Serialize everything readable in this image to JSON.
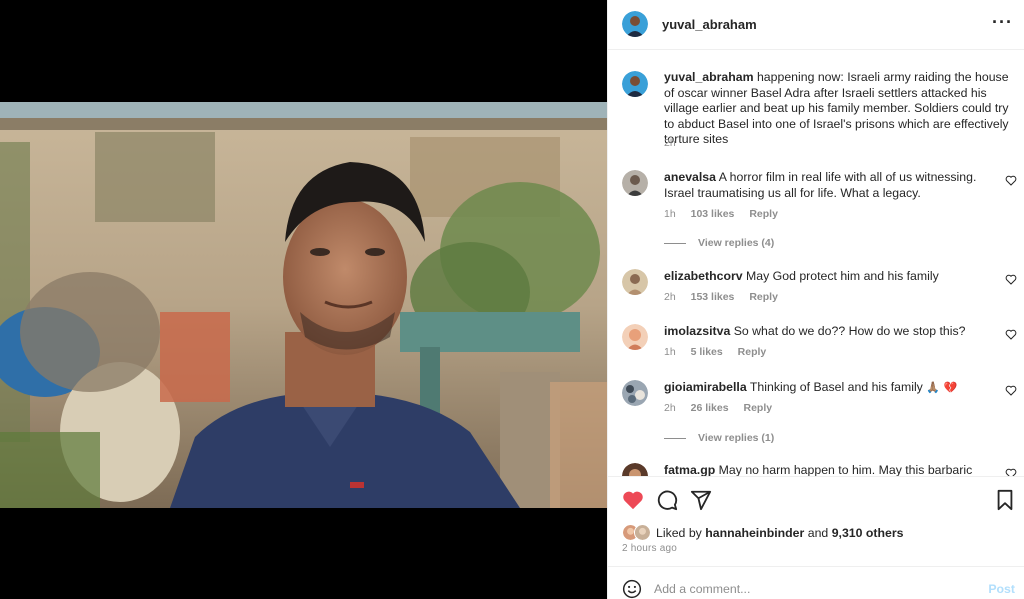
{
  "post": {
    "author": "yuval_abraham",
    "more_icon": "more-horizontal-icon",
    "caption": "happening now: Israeli army raiding the house of oscar winner Basel Adra after Israeli settlers attacked his village earlier and beat up his family member. Soldiers could try to abduct Basel into one of Israel's prisons which are effectively torture sites",
    "caption_time": "2h"
  },
  "comments": [
    {
      "user": "anevalsa",
      "text": "A horror film in real life with all of us witnessing. Israel traumatising us all for life. What a legacy.",
      "time": "1h",
      "likes": "103 likes",
      "reply": "Reply",
      "view_replies": "View replies (4)"
    },
    {
      "user": "elizabethcorv",
      "text": "May God protect him and his family",
      "time": "2h",
      "likes": "153 likes",
      "reply": "Reply"
    },
    {
      "user": "imolazsitva",
      "text": "So what do we do?? How do we stop this?",
      "time": "1h",
      "likes": "5 likes",
      "reply": "Reply"
    },
    {
      "user": "gioiamirabella",
      "text": "Thinking of Basel and his family",
      "emoji": "🙏🏽 💔",
      "time": "2h",
      "likes": "26 likes",
      "reply": "Reply",
      "view_replies": "View replies (1)"
    },
    {
      "user": "fatma.gp",
      "text": "May no harm happen to him. May this barbaric"
    }
  ],
  "actions": {
    "liked_by_prefix": "Liked by",
    "liked_by_user": "hannaheinbinder",
    "and": "and",
    "others": "9,310 others",
    "time_ago": "2 hours ago"
  },
  "add_comment": {
    "placeholder": "Add a comment...",
    "post_label": "Post"
  },
  "colors": {
    "like_red": "#ed4956",
    "post_blue_disabled": "#b2dffc"
  }
}
